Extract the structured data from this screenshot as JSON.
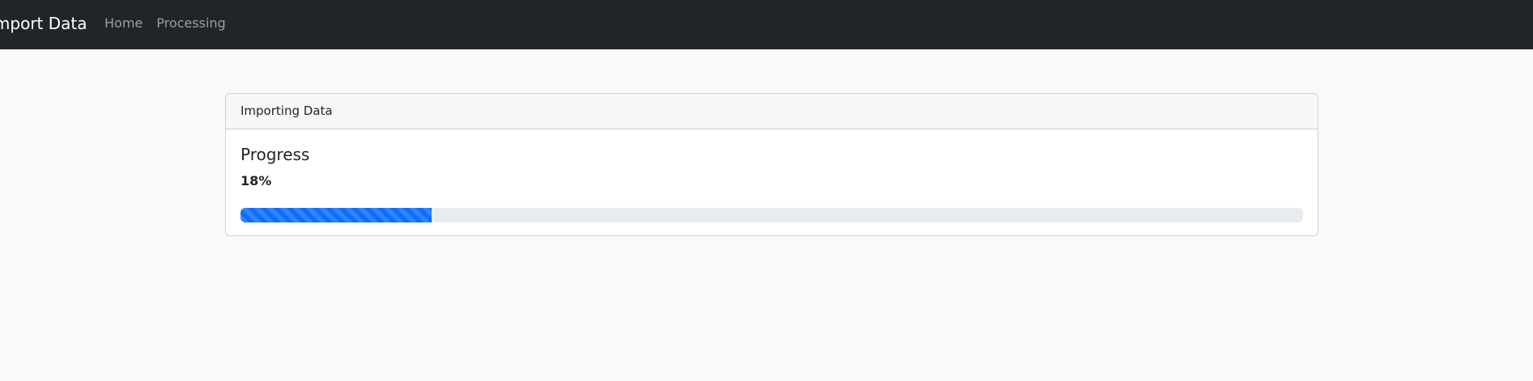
{
  "navbar": {
    "brand": "Import Data",
    "links": [
      {
        "label": "Home"
      },
      {
        "label": "Processing"
      }
    ]
  },
  "card": {
    "header": "Importing Data",
    "title": "Progress",
    "progress_label": "18%",
    "progress_value": 18
  },
  "colors": {
    "navbar_bg": "#212529",
    "progress_fill": "#0d6efd",
    "progress_track": "#e9ecef",
    "page_bg": "#f8f9fa"
  }
}
